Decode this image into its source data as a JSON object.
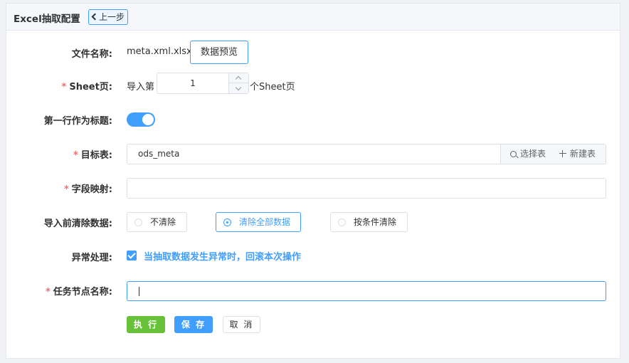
{
  "header": {
    "title": "Excel抽取配置",
    "back_label": "上一步"
  },
  "form": {
    "file_name": {
      "label": "文件名称:",
      "value": "meta.xml.xlsx",
      "preview_button": "数据预览"
    },
    "sheet": {
      "required": "*",
      "label": "Sheet页:",
      "prefix": "导入第",
      "value": "1",
      "suffix": "个Sheet页"
    },
    "first_row_header": {
      "label": "第一行作为标题:",
      "enabled": true
    },
    "target_table": {
      "required": "*",
      "label": "目标表:",
      "value": "ods_meta",
      "select_button": "选择表",
      "new_button": "新建表"
    },
    "field_mapping": {
      "required": "*",
      "label": "字段映射:",
      "value": ""
    },
    "clear_before_import": {
      "label": "导入前清除数据:",
      "options": [
        "不清除",
        "清除全部数据",
        "按条件清除"
      ],
      "selected": "清除全部数据"
    },
    "error_handling": {
      "label": "异常处理:",
      "checked": true,
      "option_label": "当抽取数据发生异常时，回滚本次操作"
    },
    "task_node_name": {
      "required": "*",
      "label": "任务节点名称:",
      "value": ""
    }
  },
  "actions": {
    "run": "执 行",
    "save": "保 存",
    "cancel": "取 消"
  },
  "colors": {
    "primary": "#409eff",
    "success": "#67c23a",
    "required": "#f56c6c"
  }
}
